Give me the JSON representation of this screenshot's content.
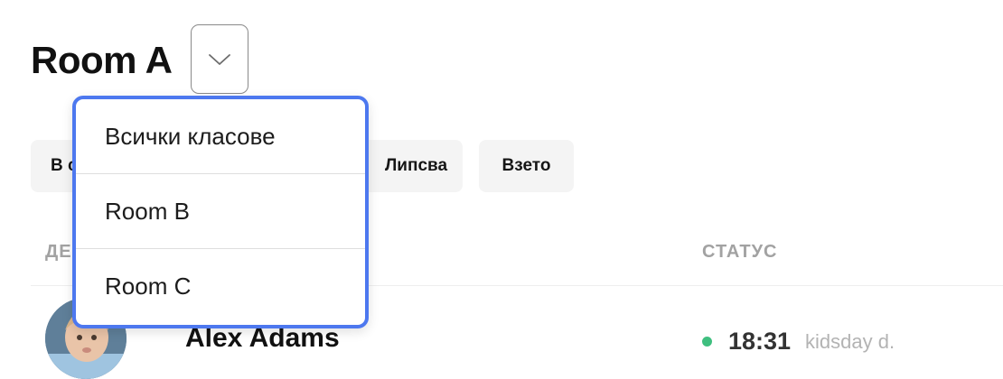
{
  "header": {
    "title": "Room A"
  },
  "filters": {
    "chips": [
      {
        "label": "В с"
      },
      {
        "label": "Липсва"
      },
      {
        "label": "Взето"
      }
    ]
  },
  "table": {
    "columns": {
      "child": "ДЕ",
      "status": "СТАТУС"
    },
    "rows": [
      {
        "name": "Alex Adams",
        "status_color": "#3fbf7f",
        "status_time": "18:31",
        "status_by": "kidsday d."
      }
    ]
  },
  "room_dropdown": {
    "items": [
      {
        "label": "Всички класове"
      },
      {
        "label": "Room B"
      },
      {
        "label": "Room C"
      }
    ]
  },
  "theme": {
    "accent": "#4d78ef",
    "status_ok": "#3fbf7f"
  },
  "icons": {
    "toggle": "chevron-down-icon",
    "avatar": "child-photo-avatar"
  }
}
